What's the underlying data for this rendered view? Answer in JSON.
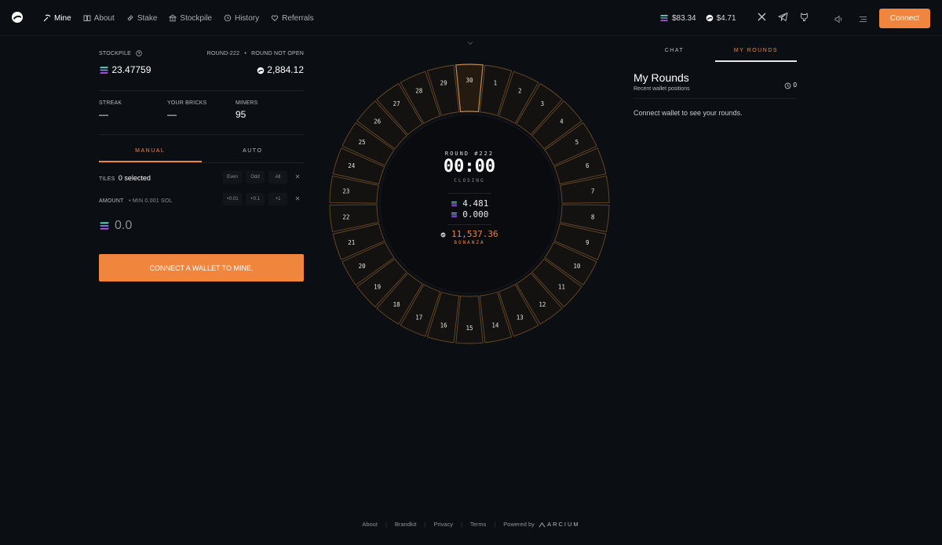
{
  "nav": {
    "logo_icon": "ore-logo-icon",
    "items": [
      {
        "label": "Mine",
        "icon": "pickaxe-icon",
        "active": true
      },
      {
        "label": "About",
        "icon": "book-icon",
        "active": false
      },
      {
        "label": "Stake",
        "icon": "link-icon",
        "active": false
      },
      {
        "label": "Stockpile",
        "icon": "bank-icon",
        "active": false
      },
      {
        "label": "History",
        "icon": "history-icon",
        "active": false
      },
      {
        "label": "Referrals",
        "icon": "heart-icon",
        "active": false
      }
    ],
    "sol_price": "$83.34",
    "ore_price": "$4.71",
    "connect_label": "Connect"
  },
  "left": {
    "stockpile_label": "STOCKPILE",
    "stockpile_value": "23.47759",
    "round_label": "ROUND-222",
    "round_status": "ROUND NOT OPEN",
    "ore_value": "2,884.12",
    "streak_label": "STREAK",
    "streak_value": "—",
    "bricks_label": "YOUR BRICKS",
    "bricks_value": "—",
    "miners_label": "MINERS",
    "miners_value": "95",
    "tab_manual": "MANUAL",
    "tab_auto": "AUTO",
    "tiles_label": "TILES",
    "tiles_selected": "0 selected",
    "tile_buttons": [
      "Even",
      "Odd",
      "All"
    ],
    "amount_label": "AMOUNT",
    "amount_min": "• MIN 0.001 SOL",
    "amount_buttons": [
      "+0.01",
      "+0.1",
      "+1"
    ],
    "amount_value": "0.0",
    "mine_button": "CONNECT A WALLET TO MINE."
  },
  "wheel": {
    "round_label": "ROUND #222",
    "timer": "00:00",
    "status": "CLOSING",
    "sol_total": "4.481",
    "sol_deployed": "0.000",
    "bonanza_value": "11,537.36",
    "bonanza_label": "BONANZA",
    "tiles": [
      "30",
      "1",
      "2",
      "3",
      "4",
      "5",
      "6",
      "7",
      "8",
      "9",
      "10",
      "11",
      "12",
      "13",
      "14",
      "15",
      "16",
      "17",
      "18",
      "19",
      "20",
      "21",
      "22",
      "23",
      "24",
      "25",
      "26",
      "27",
      "28",
      "29"
    ],
    "highlighted": "30",
    "accent": "#f0853e"
  },
  "right": {
    "tab_chat": "CHAT",
    "tab_rounds": "MY ROUNDS",
    "title": "My Rounds",
    "subtitle": "Recent wallet positions",
    "count": "0",
    "empty_text": "Connect wallet to see your rounds."
  },
  "footer": {
    "links": [
      "About",
      "Brandkit",
      "Privacy",
      "Terms"
    ],
    "powered_by": "Powered by",
    "brand": "ARCIUM"
  }
}
